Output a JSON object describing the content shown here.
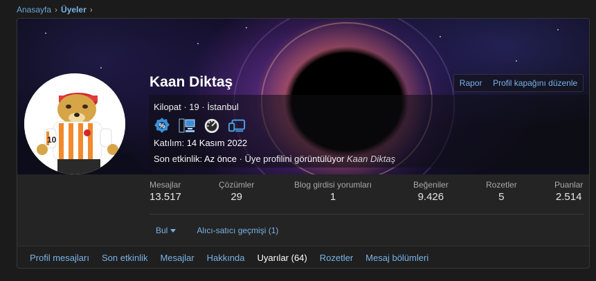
{
  "breadcrumb": [
    {
      "label": "Anasayfa"
    },
    {
      "label": "Üyeler"
    }
  ],
  "profile": {
    "username": "Kaan Diktaş",
    "blurb": "Kilopat · 19 · İstanbul",
    "joined_label": "Katılım:",
    "joined_value": "14 Kasım 2022",
    "activity_label": "Son etkinlik:",
    "activity_time": "Az önce",
    "activity_text": "Üye profilini görüntülüyor",
    "activity_target": "Kaan Diktaş",
    "badges": [
      "gear-badge-icon",
      "computer-badge-icon",
      "speedometer-badge-icon",
      "devices-badge-icon"
    ]
  },
  "actions": {
    "report": "Rapor",
    "edit_cover": "Profil kapağını düzenle"
  },
  "stats": [
    {
      "label": "Mesajlar",
      "value": "13.517"
    },
    {
      "label": "Çözümler",
      "value": "29"
    },
    {
      "label": "Blog girdisi yorumları",
      "value": "1"
    },
    {
      "label": "Beğeniler",
      "value": "9.426"
    },
    {
      "label": "Rozetler",
      "value": "5"
    },
    {
      "label": "Puanlar",
      "value": "2.514"
    }
  ],
  "buttons": {
    "find": "Bul",
    "trade_history": "Alıcı-satıcı geçmişi (1)"
  },
  "tabs": [
    {
      "label": "Profil mesajları"
    },
    {
      "label": "Son etkinlik"
    },
    {
      "label": "Mesajlar"
    },
    {
      "label": "Hakkında"
    },
    {
      "label": "Uyarılar (64)"
    },
    {
      "label": "Rozetler"
    },
    {
      "label": "Mesaj bölümleri"
    }
  ],
  "active_tab": "Uyarılar (64)",
  "colors": {
    "accent": "#79b3e6",
    "background": "#1b1b1b",
    "card": "#242424"
  }
}
